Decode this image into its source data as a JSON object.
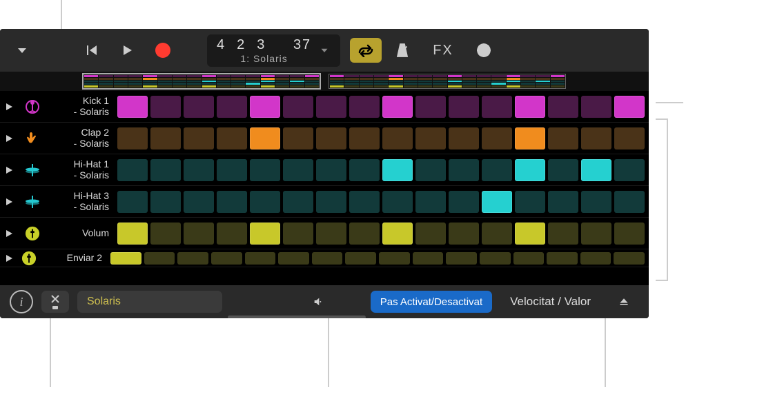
{
  "colors": {
    "magenta_on": "#d236c9",
    "magenta_off": "#4a1a47",
    "orange_on": "#f08c1e",
    "orange_off": "#4a3318",
    "cyan_on": "#25d0d0",
    "cyan_off": "#123a3a",
    "yellow_on": "#c8c82a",
    "yellow_off": "#3a3a18",
    "track_icons": {
      "kick": "#d236c9",
      "clap": "#f08c1e",
      "hihat": "#25c8d0",
      "hihat3": "#25c8d0",
      "vol": "#c8d028",
      "send": "#c8d028"
    }
  },
  "toolbar": {
    "lcd_numbers": [
      "4",
      "2",
      "3",
      "37"
    ],
    "lcd_label": "1: Solaris",
    "fx_label": "FX"
  },
  "tracks": [
    {
      "id": "kick",
      "label_l1": "Kick 1",
      "label_l2": "- Solaris",
      "color_on": "#d236c9",
      "color_off": "#4a1a47",
      "steps": [
        1,
        0,
        0,
        0,
        1,
        0,
        0,
        0,
        1,
        0,
        0,
        0,
        1,
        0,
        0,
        1
      ]
    },
    {
      "id": "clap",
      "label_l1": "Clap 2",
      "label_l2": "- Solaris",
      "color_on": "#f08c1e",
      "color_off": "#4a3318",
      "steps": [
        0,
        0,
        0,
        0,
        1,
        0,
        0,
        0,
        0,
        0,
        0,
        0,
        1,
        0,
        0,
        0
      ]
    },
    {
      "id": "hihat",
      "label_l1": "Hi-Hat 1",
      "label_l2": "- Solaris",
      "color_on": "#25d0d0",
      "color_off": "#123a3a",
      "steps": [
        0,
        0,
        0,
        0,
        0,
        0,
        0,
        0,
        1,
        0,
        0,
        0,
        1,
        0,
        1,
        0
      ]
    },
    {
      "id": "hihat3",
      "label_l1": "Hi-Hat 3",
      "label_l2": "- Solaris",
      "color_on": "#25d0d0",
      "color_off": "#123a3a",
      "steps": [
        0,
        0,
        0,
        0,
        0,
        0,
        0,
        0,
        0,
        0,
        0,
        1,
        0,
        0,
        0,
        0
      ]
    },
    {
      "id": "vol",
      "label_l1": "Volum",
      "label_l2": "",
      "color_on": "#c8c82a",
      "color_off": "#3a3a18",
      "steps": [
        1,
        0,
        0,
        0,
        1,
        0,
        0,
        0,
        1,
        0,
        0,
        0,
        1,
        0,
        0,
        0
      ],
      "single_line": true
    },
    {
      "id": "send",
      "label_l1": "Enviar 2",
      "label_l2": "",
      "color_on": "#c8c82a",
      "color_off": "#3a3a18",
      "steps": [
        1,
        0,
        0,
        0,
        0,
        0,
        0,
        0,
        0,
        0,
        0,
        0,
        0,
        0,
        0,
        0
      ],
      "single_line": true,
      "partial": true
    }
  ],
  "bottom": {
    "kit_name": "Solaris",
    "mode_active": "Pas Activat/Desactivat",
    "mode_inactive": "Velocitat / Valor"
  },
  "overview_patterns": [
    {
      "selected": true
    },
    {
      "selected": false
    }
  ]
}
